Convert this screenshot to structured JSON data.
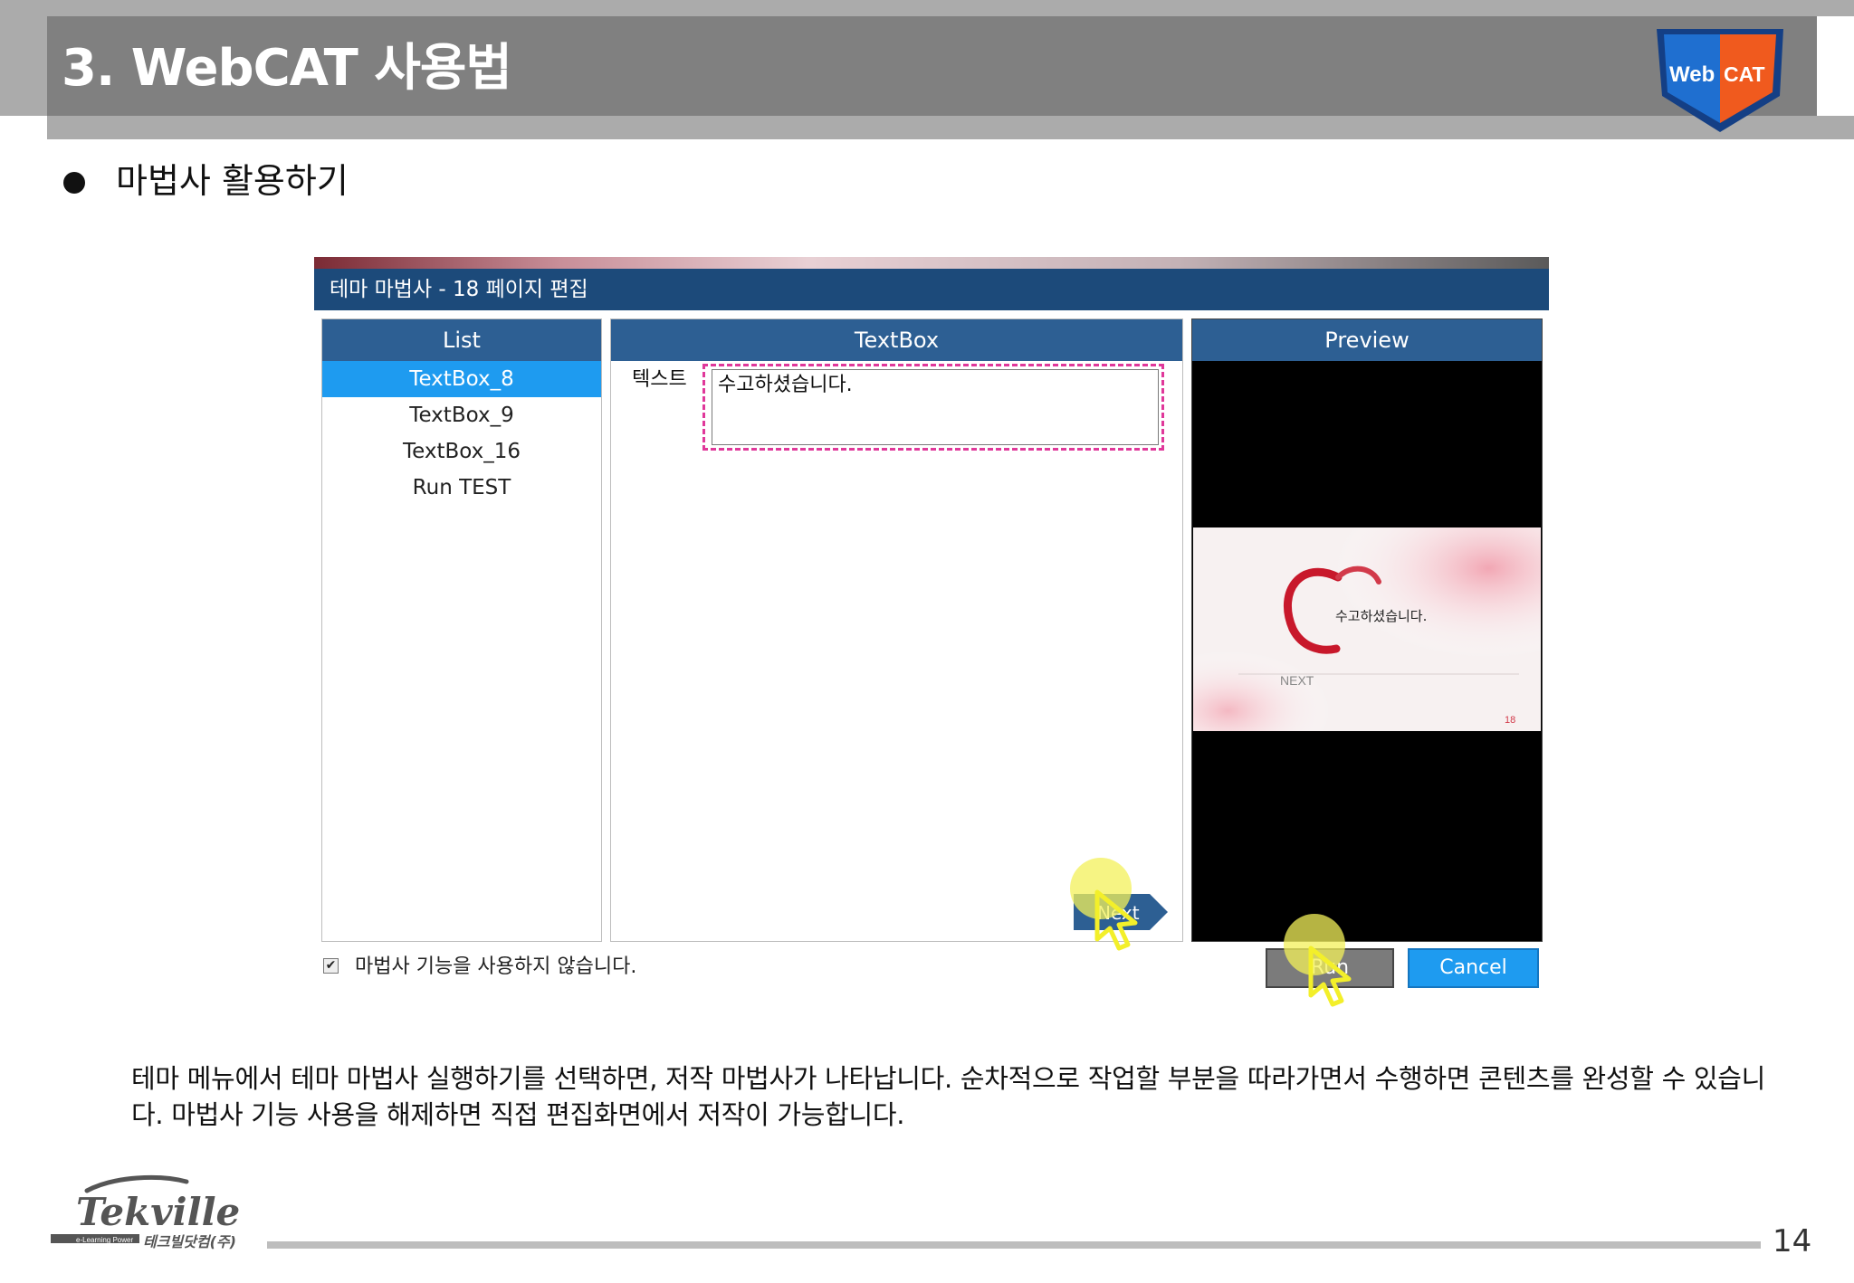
{
  "header": {
    "title": "3. WebCAT 사용법",
    "logo_text_web": "Web",
    "logo_text_cat": "CAT"
  },
  "section": {
    "subtitle": "마법사 활용하기"
  },
  "dialog": {
    "title": "테마 마법사 - 18 페이지 편집",
    "list_header": "List",
    "list_items": [
      "TextBox_8",
      "TextBox_9",
      "TextBox_16",
      "Run TEST"
    ],
    "textbox_header": "TextBox",
    "text_label": "텍스트",
    "text_value": "수고하셨습니다.",
    "preview_header": "Preview",
    "preview_text": "수고하셨습니다.",
    "preview_next": "NEXT",
    "preview_page": "18",
    "next_label": "Next",
    "checkbox_label": "마법사 기능을 사용하지 않습니다.",
    "run_label": "Run",
    "cancel_label": "Cancel"
  },
  "description": "테마 메뉴에서 테마 마법사 실행하기를 선택하면, 저작 마법사가 나타납니다. 순차적으로 작업할 부분을 따라가면서 수행하면 콘텐츠를 완성할 수 있습니다. 마법사 기능 사용을 해제하면 직접 편집화면에서 저작이 가능합니다.",
  "footer": {
    "company_logo": "Tekville",
    "company_tagline": "e-Learning Power",
    "company_korean": "테크빌닷컴(주)",
    "page_number": "14"
  },
  "colors": {
    "header_bar": "#808080",
    "dialog_titlebar": "#1c4a7a",
    "panel_header": "#2d5f93",
    "selected": "#1e9bf0",
    "dashed_highlight": "#e0389a",
    "logo_blue": "#1f6fd0",
    "logo_orange": "#f05a1e"
  }
}
